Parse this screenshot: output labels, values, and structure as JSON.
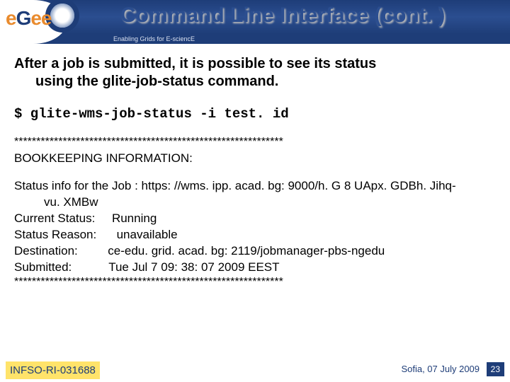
{
  "header": {
    "title": "Command Line Interface (cont. )",
    "tagline": "Enabling Grids for E-sciencE",
    "logo_text_1": "e",
    "logo_text_2": "G",
    "logo_text_3": "ee"
  },
  "body": {
    "intro_line1": "After a job is submitted, it is possible to see its status",
    "intro_line2": "using the glite-job-status command.",
    "command": "$ glite-wms-job-status -i test. id",
    "sep1": "*************************************************************",
    "section_heading": "BOOKKEEPING INFORMATION:",
    "status_info_line": "Status info for the Job : https: //wms. ipp. acad. bg: 9000/h. G 8 UApx. GDBh. Jihq-",
    "status_info_cont": "vu. XMBw",
    "current_status": "Current Status:     Running",
    "status_reason": "Status Reason:      unavailable",
    "destination": "Destination:         ce-edu. grid. acad. bg: 2119/jobmanager-pbs-ngedu",
    "submitted": "Submitted:           Tue Jul  7 09: 38: 07 2009 EEST",
    "sep2": "*************************************************************"
  },
  "footer": {
    "left": "INFSO-RI-031688",
    "right_text": "Sofia, 07 July 2009",
    "page_number": "23"
  }
}
